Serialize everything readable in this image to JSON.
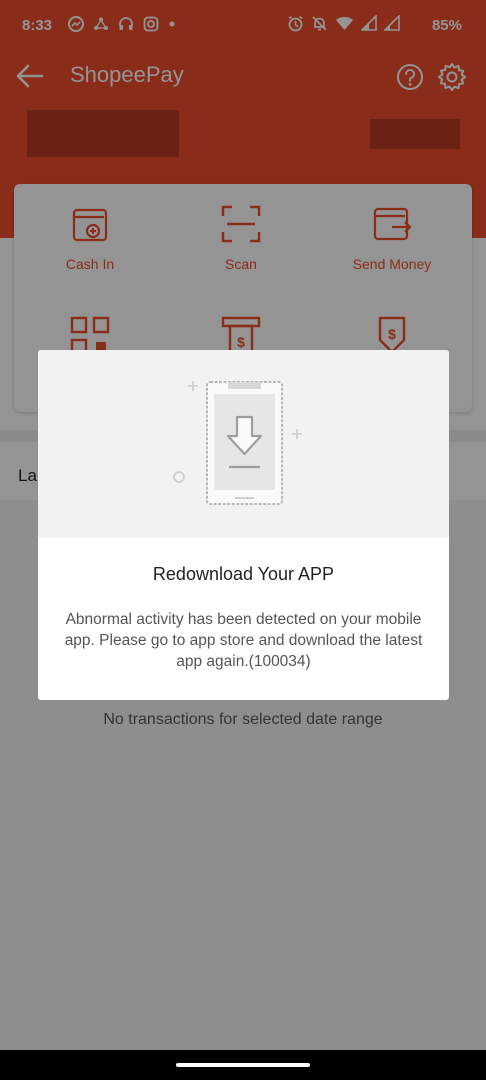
{
  "status_bar": {
    "time": "8:33",
    "battery": "85%",
    "left_icons": [
      "messenger-icon",
      "share-icon",
      "headphones-icon",
      "instagram-icon",
      "dot-icon"
    ],
    "right_icons": [
      "alarm-icon",
      "mute-icon",
      "wifi-icon",
      "signal-icon",
      "signal-icon"
    ]
  },
  "app_bar": {
    "title": "ShopeePay",
    "back_icon": "back-arrow-icon",
    "help_icon": "help-icon",
    "settings_icon": "gear-icon"
  },
  "actions": {
    "cash_in": "Cash In",
    "scan": "Scan",
    "send_money": "Send Money"
  },
  "section": {
    "label": "La"
  },
  "transactions": {
    "empty_text": "No transactions for selected date range"
  },
  "modal": {
    "title": "Redownload Your APP",
    "body": "Abnormal activity has been detected on your mobile app. Please go to app store and download the latest app again.(100034)"
  },
  "colors": {
    "brand": "#ee4d2d",
    "overlay": "rgba(0,0,0,0.42)"
  }
}
